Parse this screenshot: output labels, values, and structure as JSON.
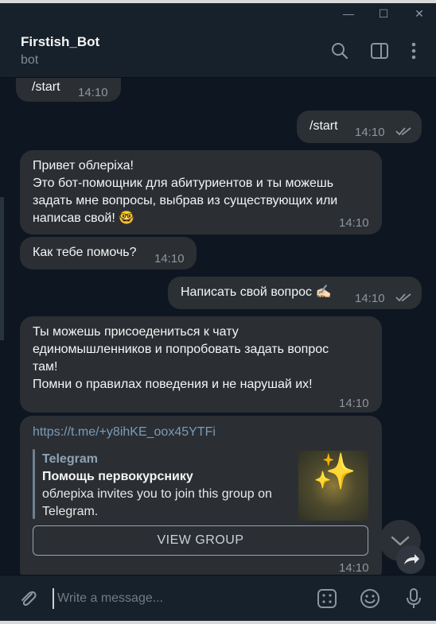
{
  "window": {
    "minimize_label": "—",
    "maximize_label": "☐",
    "close_label": "✕"
  },
  "header": {
    "title": "Firstish_Bot",
    "status": "bot"
  },
  "messages": [
    {
      "dir": "in",
      "text": "/start",
      "time": "14:10"
    },
    {
      "dir": "out",
      "text": "/start",
      "time": "14:10"
    },
    {
      "dir": "in",
      "text": "Привет облеріха!\nЭто бот-помощник для абитуриентов и ты можешь\nзадать мне вопросы, выбрав из существующих или\nнаписав свой! 🤓",
      "time": "14:10"
    },
    {
      "dir": "in",
      "text": "Как тебе помочь?",
      "time": "14:10"
    },
    {
      "dir": "out",
      "text": "Написать свой вопрос ✍🏻",
      "time": "14:10"
    },
    {
      "dir": "in",
      "text": "Ты можешь присоедениться к чату\nединомышленников и попробовать задать вопрос\nтам!\nПомни о правилах поведения и не нарушай их!",
      "time": "14:10"
    }
  ],
  "link_message": {
    "url": "https://t.me/+y8ihKE_oox45YTFi",
    "preview_site": "Telegram",
    "preview_title": "Помощь первокурснику",
    "preview_description": "облеріха invites you to join this group on Telegram.",
    "thumb_emoji": "✨",
    "button_label": "VIEW GROUP",
    "time": "14:10"
  },
  "composer": {
    "placeholder": "Write a message..."
  },
  "icons": {
    "search": "search-icon",
    "sidebar": "sidebar-toggle-icon",
    "more": "more-vertical-icon",
    "attach": "paperclip-icon",
    "commands": "bot-commands-icon",
    "emoji": "emoji-icon",
    "mic": "microphone-icon",
    "scroll": "chevron-down-icon",
    "share": "share-icon"
  },
  "colors": {
    "background": "#0e1621",
    "bubble": "#2b2f34",
    "link": "#7b9bb6",
    "accent_time": "#8d959c"
  }
}
